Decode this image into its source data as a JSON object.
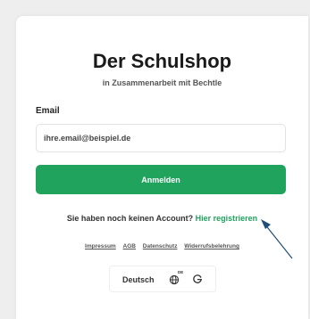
{
  "page": {
    "title": "Der Schulshop",
    "subtitle": "in Zusammenarbeit mit Bechtle"
  },
  "login_form": {
    "email_label": "Email",
    "email_placeholder": "ihre.email@beispiel.de",
    "email_value": "",
    "submit_label": "Anmelden"
  },
  "register": {
    "prompt": "Sie haben noch keinen Account?",
    "link_label": "Hier registrieren"
  },
  "footer": {
    "links": [
      "Impressum",
      "AGB",
      "Datenschutz",
      "Widerrufsbelehrung"
    ]
  },
  "language": {
    "current": "Deutsch",
    "code": "DE",
    "globe_icon": "globe-icon",
    "translate_icon": "google-translate-icon"
  },
  "colors": {
    "primary": "#20a35d",
    "background": "#eeeeee",
    "card": "#ffffff",
    "annotation": "#1f4e79"
  }
}
